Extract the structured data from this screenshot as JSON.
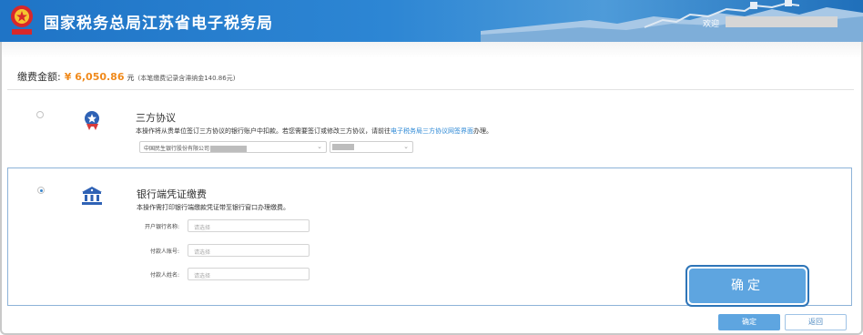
{
  "header": {
    "title": "国家税务总局江苏省电子税务局",
    "welcome": "欢迎"
  },
  "payment": {
    "amount_label": "缴费金额:",
    "amount_value": "¥ 6,050.86",
    "unit": "元",
    "note": "(本笔缴费记录含滞纳金140.86元)"
  },
  "option_tripartite": {
    "title": "三方协议",
    "desc_prefix": "本操作将从贵单位签订三方协议的银行账户中扣款。若您需要签订或修改三方协议，请前往",
    "desc_link": "电子税务局三方协议网签界面",
    "desc_suffix": "办理。",
    "bank_select_value": "中国民生银行股份有限公司",
    "icon": "shield-star-icon"
  },
  "option_bank_voucher": {
    "title": "银行端凭证缴费",
    "desc": "本操作需打印银行端缴款凭证带至银行窗口办理缴费。",
    "fields": [
      {
        "label": "开户银行名称:",
        "placeholder": "请选择"
      },
      {
        "label": "付款人账号:",
        "placeholder": "请选择"
      },
      {
        "label": "付款人姓名:",
        "placeholder": "请选择"
      }
    ],
    "icon": "bank-icon"
  },
  "actions": {
    "big_confirm": "确定",
    "confirm": "确定",
    "back": "返回"
  },
  "colors": {
    "header_blue": "#2d86d4",
    "amount_orange": "#f08a1c",
    "button_blue": "#5ea5e0",
    "link_blue": "#2f8ad6"
  }
}
